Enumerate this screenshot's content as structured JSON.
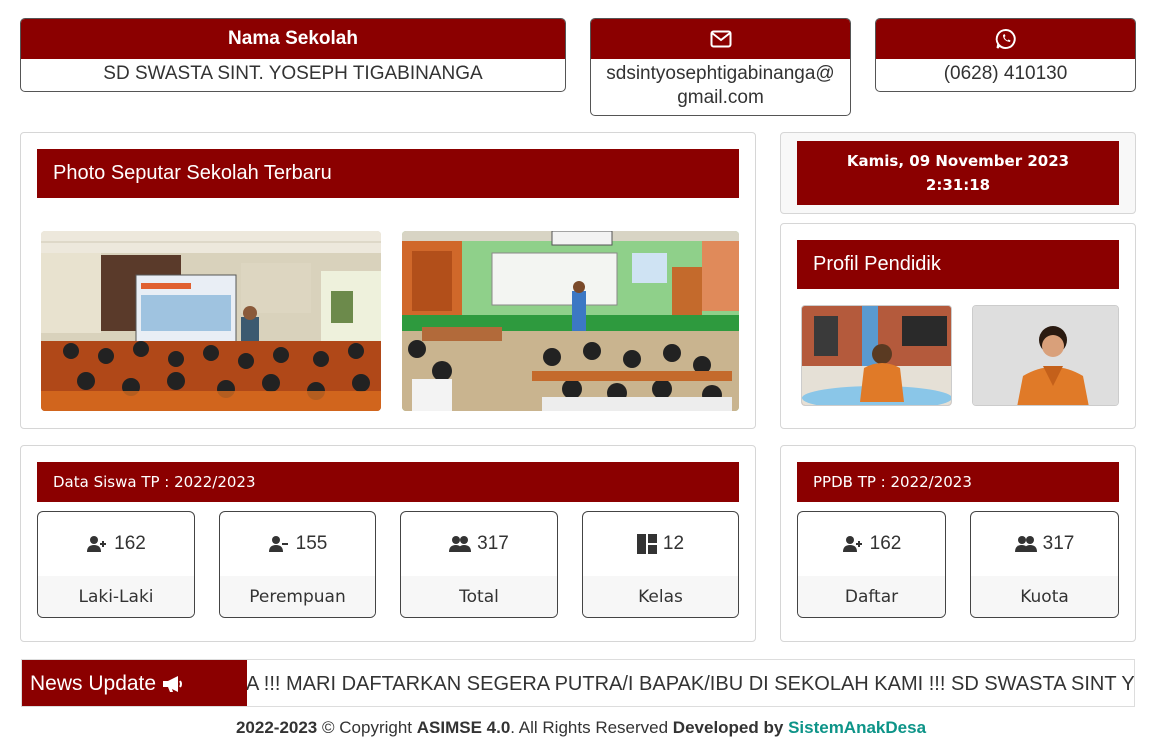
{
  "school": {
    "header": "Nama Sekolah",
    "name": "SD SWASTA SINT. YOSEPH TIGABINANGA"
  },
  "email": {
    "icon": "envelope-icon",
    "line1": "sdsintyosephtigabinanga@",
    "line2": "gmail.com"
  },
  "phone": {
    "icon": "whatsapp-icon",
    "number": "(0628) 410130"
  },
  "photos": {
    "title": "Photo Seputar Sekolah Terbaru"
  },
  "datetime": {
    "date": "Kamis, 09 November 2023",
    "time": "2:31:18"
  },
  "profil": {
    "title": "Profil Pendidik"
  },
  "siswa": {
    "title": "Data Siswa TP : 2022/2023",
    "stats": [
      {
        "icon": "user-plus-icon",
        "value": "162",
        "label": "Laki-Laki"
      },
      {
        "icon": "user-minus-icon",
        "value": "155",
        "label": "Perempuan"
      },
      {
        "icon": "users-icon",
        "value": "317",
        "label": "Total"
      },
      {
        "icon": "layout-icon",
        "value": "12",
        "label": "Kelas"
      }
    ]
  },
  "ppdb": {
    "title": "PPDB TP : 2022/2023",
    "stats": [
      {
        "icon": "user-plus-icon",
        "value": "162",
        "label": "Daftar"
      },
      {
        "icon": "users-icon",
        "value": "317",
        "label": "Kuota"
      }
    ]
  },
  "news": {
    "label": "News Update",
    "icon": "megaphone-icon",
    "text": "A !!! MARI DAFTARKAN SEGERA PUTRA/I BAPAK/IBU DI SEKOLAH KAMI !!! SD SWASTA SINT YOSEPH"
  },
  "footer": {
    "years": "2022-2023",
    "copyright": " © Copyright ",
    "product": "ASIMSE 4.0",
    "rights": ". All Rights Reserved ",
    "developed": "Developed by ",
    "developer": "SistemAnakDesa"
  },
  "colors": {
    "maroon": "#8b0000",
    "developer_link": "#0d9488"
  }
}
